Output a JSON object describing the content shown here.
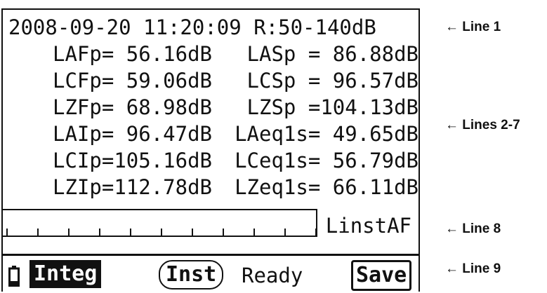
{
  "header": {
    "datetime": "2008-09-20 11:20:09",
    "range": "R:50-140dB"
  },
  "measurements": [
    {
      "left_label": "LAFp=",
      "left_value": " 56.16dB",
      "right_label": "LASp =",
      "right_value": " 86.88dB"
    },
    {
      "left_label": "LCFp=",
      "left_value": " 59.06dB",
      "right_label": "LCSp =",
      "right_value": " 96.57dB"
    },
    {
      "left_label": "LZFp=",
      "left_value": " 68.98dB",
      "right_label": "LZSp =",
      "right_value": "104.13dB"
    },
    {
      "left_label": "LAIp=",
      "left_value": " 96.47dB",
      "right_label": "LAeq1s=",
      "right_value": " 49.65dB"
    },
    {
      "left_label": "LCIp=",
      "left_value": "105.16dB",
      "right_label": "LCeq1s=",
      "right_value": " 56.79dB"
    },
    {
      "left_label": "LZIp=",
      "left_value": "112.78dB",
      "right_label": "LZeq1s=",
      "right_value": " 66.11dB"
    }
  ],
  "level_bar": {
    "mode_label": "LinstAF",
    "level_fraction": 0.0,
    "tick_count": 10
  },
  "status_bar": {
    "battery_icon": "battery-low-icon",
    "integ_label": "Integ",
    "inst_label": "Inst",
    "status_text": "Ready",
    "save_label": "Save"
  },
  "callouts": {
    "line1": "← Line 1",
    "lines2_7": "← Lines 2-7",
    "line8": "← Line 8",
    "line9": "← Line 9"
  }
}
